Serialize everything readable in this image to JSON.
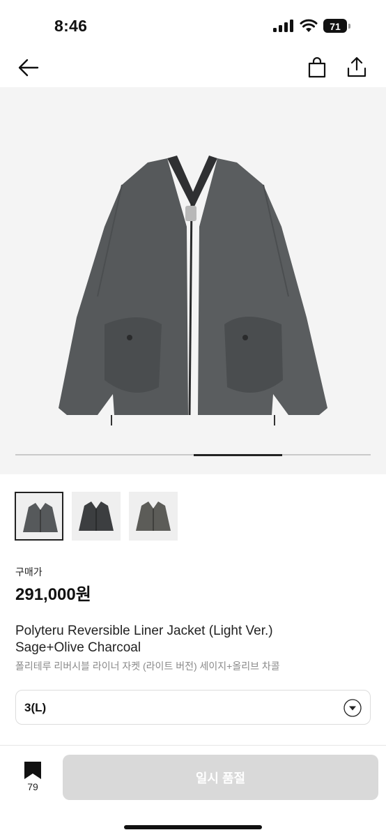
{
  "status": {
    "time": "8:46",
    "battery": "71"
  },
  "nav": {
    "back_icon": "arrow-left-icon",
    "bag_icon": "shopping-bag-icon",
    "share_icon": "share-icon"
  },
  "product": {
    "price_label": "구매가",
    "price": "291,000원",
    "title_en_line1": "Polyteru Reversible Liner Jacket (Light Ver.)",
    "title_en_line2": "Sage+Olive Charcoal",
    "title_ko": "폴리테루 리버시블 라이너 자켓 (라이트 버전) 세이지+올리브 차콜",
    "selected_size": "3(L)",
    "carousel_progress": 0.6
  },
  "colors": {
    "jacket_main": "#565a5c",
    "jacket_dark": "#3c3e40",
    "jacket_olive": "#5c5c58"
  },
  "bottom": {
    "bookmark_count": "79",
    "action_label": "일시 품절"
  }
}
